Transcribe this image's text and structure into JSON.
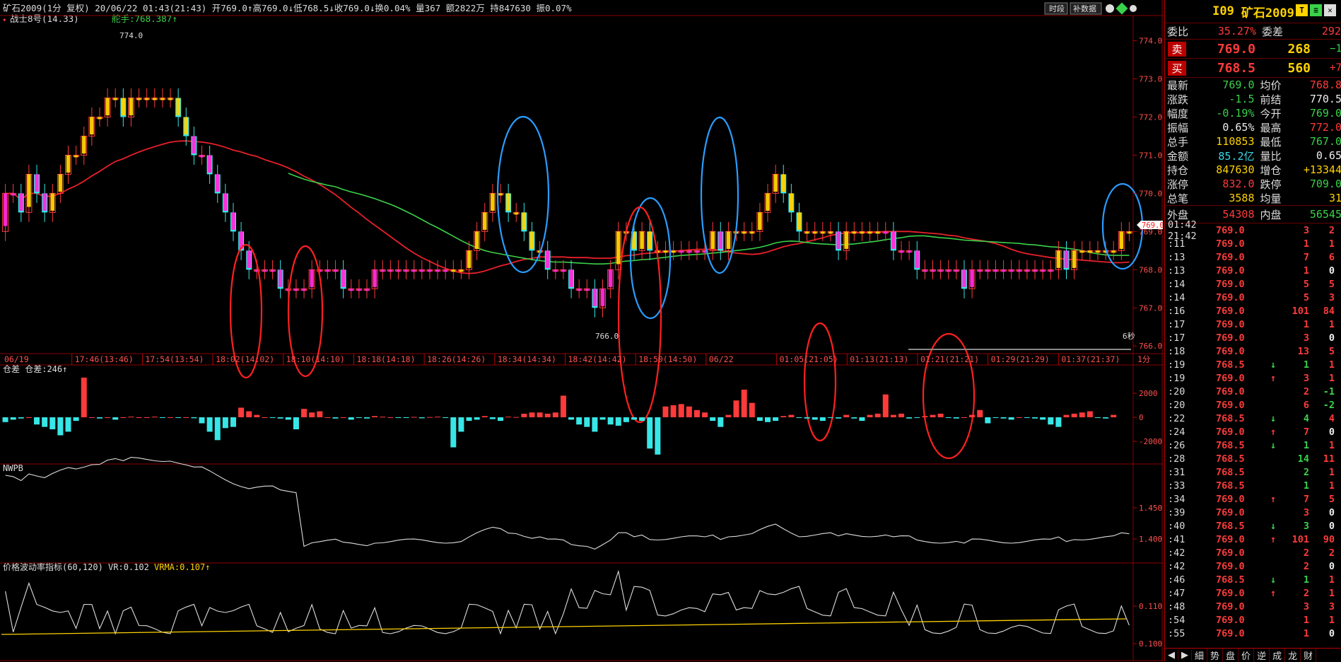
{
  "header": {
    "line1": "矿石2009(1分 复权) 20/06/22 01:43(21:43)  开769.0↑高769.0↓低768.5↓收769.0↓换0.04% 量367 额2822万 持847630 振0.07%",
    "line2_a": "战士8号(14.33)",
    "line2_b": "舵手:768.387↑",
    "btn_period": "时段",
    "btn_data": "补数据"
  },
  "price_axis": [
    "774.0",
    "773.0",
    "772.0",
    "771.0",
    "770.0",
    "769.0",
    "768.0",
    "767.0",
    "766.0"
  ],
  "price_tag": "769.0",
  "hi_label": "774.0",
  "lo_label": "766.0",
  "sec_label": "6秒",
  "time_axis": [
    "06/19",
    "17:46(13:46)",
    "17:54(13:54)",
    "18:02(14:02)",
    "18:10(14:10)",
    "18:18(14:18)",
    "18:26(14:26)",
    "18:34(14:34)",
    "18:42(14:42)",
    "18:50(14:50)",
    "06/22",
    "01:05(21:05)",
    "01:13(21:13)",
    "01:21(21:21)",
    "01:29(21:29)",
    "01:37(21:37)",
    "1分"
  ],
  "ind1": {
    "title": "仓差 仓差:246↑",
    "axis": [
      "2000",
      "0",
      "-2000"
    ]
  },
  "ind2": {
    "title": "NWPB",
    "axis": [
      "1.450",
      "1.400"
    ]
  },
  "ind3": {
    "title_a": "价格波动率指标(60,120) VR:0.102 ",
    "title_b": "VRMA:0.107↑",
    "axis": [
      "0.110",
      "0.100"
    ]
  },
  "chart_data": {
    "type": "candlestick",
    "ylim": [
      765.8,
      774.4
    ],
    "open": [
      769,
      770,
      770,
      769.5,
      770.5,
      770,
      769.5,
      770,
      770.5,
      771,
      771,
      771.5,
      772,
      772,
      772.5,
      772.5,
      772,
      772.5,
      772.5,
      772.5,
      772.5,
      772.5,
      772.5,
      772,
      771.5,
      771,
      771,
      770.5,
      770,
      769.5,
      769,
      768.5,
      768,
      768,
      768,
      768,
      767.5,
      767.5,
      767.5,
      767.5,
      768,
      768,
      768,
      768,
      767.5,
      767.5,
      767.5,
      767.5,
      768,
      768,
      768,
      768,
      768,
      768,
      768,
      768,
      768,
      768,
      768,
      768,
      768.5,
      769,
      769.5,
      770,
      770,
      769.5,
      769.5,
      769,
      768.5,
      768.5,
      768,
      768,
      768,
      767.5,
      767.5,
      767.5,
      767,
      767.5,
      768,
      769,
      769,
      768.5,
      769,
      768.5,
      768.5,
      768.5,
      768.5,
      768.5,
      768.5,
      768.5,
      768.5,
      769,
      768.5,
      769,
      769,
      769,
      769,
      769.5,
      770,
      770.5,
      770,
      769.5,
      769,
      769,
      769,
      769,
      769,
      768.5,
      769,
      769,
      769,
      769,
      769,
      769,
      768.5,
      768.5,
      768.5,
      768,
      768,
      768,
      768,
      768,
      768,
      767.5,
      768,
      768,
      768,
      768,
      768,
      768,
      768,
      768,
      768,
      768,
      768,
      768.5,
      768,
      768.5,
      768.5,
      768.5,
      768.5,
      768.5,
      768.5,
      769
    ],
    "close": [
      770,
      770,
      769.5,
      770.5,
      770,
      769.5,
      770,
      770.5,
      771,
      771,
      771.5,
      772,
      772,
      772.5,
      772.5,
      772,
      772.5,
      772.5,
      772.5,
      772.5,
      772.5,
      772.5,
      772,
      771.5,
      771,
      771,
      770.5,
      770,
      769.5,
      769,
      768.5,
      768,
      768,
      768,
      768,
      767.5,
      767.5,
      767.5,
      767.5,
      768,
      768,
      768,
      768,
      767.5,
      767.5,
      767.5,
      767.5,
      768,
      768,
      768,
      768,
      768,
      768,
      768,
      768,
      768,
      768,
      768,
      768,
      768.5,
      769,
      769.5,
      770,
      770,
      769.5,
      769.5,
      769,
      768.5,
      768.5,
      768,
      768,
      768,
      767.5,
      767.5,
      767.5,
      767,
      767.5,
      768,
      769,
      769,
      768.5,
      769,
      768.5,
      768.5,
      768.5,
      768.5,
      768.5,
      768.5,
      768.5,
      768.5,
      769,
      768.5,
      769,
      769,
      769,
      769,
      769.5,
      770,
      770.5,
      770,
      769.5,
      769,
      769,
      769,
      769,
      769,
      768.5,
      769,
      769,
      769,
      769,
      769,
      769,
      768.5,
      768.5,
      768.5,
      768,
      768,
      768,
      768,
      768,
      768,
      767.5,
      768,
      768,
      768,
      768,
      768,
      768,
      768,
      768,
      768,
      768,
      768,
      768.5,
      768,
      768.5,
      768.5,
      768.5,
      768.5,
      768.5,
      768.5,
      769,
      769
    ],
    "oi_diff": [
      -400,
      -200,
      -100,
      0,
      -600,
      -800,
      -1000,
      -1500,
      -1200,
      -300,
      3300,
      0,
      -100,
      0,
      -200,
      0,
      50,
      0,
      0,
      50,
      -30,
      0,
      -50,
      0,
      -80,
      -500,
      -1200,
      -1900,
      -900,
      -800,
      800,
      500,
      200,
      0,
      -50,
      -100,
      -200,
      -1000,
      700,
      400,
      500,
      0,
      -100,
      0,
      -200,
      -50,
      -100,
      100,
      50,
      0,
      -30,
      -50,
      30,
      -80,
      20,
      50,
      -60,
      -2500,
      -1200,
      -300,
      -200,
      100,
      -150,
      -300,
      50,
      20,
      300,
      400,
      400,
      300,
      400,
      1800,
      -200,
      -600,
      -800,
      -1200,
      -200,
      -600,
      -700,
      -400,
      -200,
      -300,
      -2600,
      -3100,
      900,
      1000,
      1100,
      900,
      600,
      400,
      -300,
      -800,
      200,
      1400,
      2300,
      1200,
      -300,
      -400,
      -300,
      100,
      200,
      -50,
      -100,
      -200,
      -300,
      -50,
      -100,
      200,
      -100,
      -300,
      200,
      300,
      1900,
      200,
      300,
      -100,
      -50,
      100,
      200,
      300,
      -50,
      -100,
      0,
      200,
      600,
      -500,
      -50,
      -100,
      -200,
      0,
      -50,
      -100,
      -200,
      -600,
      -800,
      200,
      300,
      400,
      500,
      -50,
      -100,
      200
    ]
  },
  "panel": {
    "code": "I09",
    "name": "矿石2009",
    "wb_lbl": "委比",
    "wb": "35.27%",
    "wc_lbl": "委差",
    "wc": "292",
    "sell_lbl": "卖",
    "sell_price": "769.0",
    "sell_vol": "268",
    "sell_chg": "−1",
    "buy_lbl": "买",
    "buy_price": "768.5",
    "buy_vol": "560",
    "buy_chg": "+7",
    "stats": [
      {
        "l1": "最新",
        "v1": "769.0",
        "c1": "green",
        "l2": "均价",
        "v2": "768.8",
        "c2": "red"
      },
      {
        "l1": "涨跌",
        "v1": "-1.5",
        "c1": "green",
        "l2": "前结",
        "v2": "770.5",
        "c2": "white"
      },
      {
        "l1": "幅度",
        "v1": "-0.19%",
        "c1": "green",
        "l2": "今开",
        "v2": "769.0",
        "c2": "green"
      },
      {
        "l1": "振幅",
        "v1": "0.65%",
        "c1": "white",
        "l2": "最高",
        "v2": "772.0",
        "c2": "red"
      },
      {
        "l1": "总手",
        "v1": "110853",
        "c1": "yellow",
        "l2": "最低",
        "v2": "767.0",
        "c2": "green"
      },
      {
        "l1": "金额",
        "v1": "85.2亿",
        "c1": "cyan",
        "l2": "量比",
        "v2": "0.65",
        "c2": "white"
      },
      {
        "l1": "持仓",
        "v1": "847630",
        "c1": "yellow",
        "l2": "增仓",
        "v2": "+13344",
        "c2": "yellow"
      },
      {
        "l1": "涨停",
        "v1": "832.0",
        "c1": "red",
        "l2": "跌停",
        "v2": "709.0",
        "c2": "green"
      },
      {
        "l1": "总笔",
        "v1": "3588",
        "c1": "yellow",
        "l2": "均量",
        "v2": "31",
        "c2": "yellow"
      }
    ],
    "outer_lbl": "外盘",
    "outer": "54308",
    "inner_lbl": "内盘",
    "inner": "56545",
    "ticks": [
      {
        "t": "01:42 21:42",
        "p": "769.0",
        "pc": "red",
        "a": "",
        "v": "3",
        "vc": "red",
        "d": "2",
        "dc": "red"
      },
      {
        "t": ":11",
        "p": "769.0",
        "pc": "red",
        "a": "",
        "v": "1",
        "vc": "red",
        "d": "1",
        "dc": "red"
      },
      {
        "t": ":13",
        "p": "769.0",
        "pc": "red",
        "a": "",
        "v": "7",
        "vc": "red",
        "d": "6",
        "dc": "red"
      },
      {
        "t": ":13",
        "p": "769.0",
        "pc": "red",
        "a": "",
        "v": "1",
        "vc": "red",
        "d": "0",
        "dc": "white"
      },
      {
        "t": ":14",
        "p": "769.0",
        "pc": "red",
        "a": "",
        "v": "5",
        "vc": "red",
        "d": "5",
        "dc": "red"
      },
      {
        "t": ":14",
        "p": "769.0",
        "pc": "red",
        "a": "",
        "v": "5",
        "vc": "red",
        "d": "3",
        "dc": "red"
      },
      {
        "t": ":16",
        "p": "769.0",
        "pc": "red",
        "a": "",
        "v": "101",
        "vc": "red",
        "d": "84",
        "dc": "red"
      },
      {
        "t": ":17",
        "p": "769.0",
        "pc": "red",
        "a": "",
        "v": "1",
        "vc": "red",
        "d": "1",
        "dc": "red"
      },
      {
        "t": ":17",
        "p": "769.0",
        "pc": "red",
        "a": "",
        "v": "3",
        "vc": "red",
        "d": "0",
        "dc": "white"
      },
      {
        "t": ":18",
        "p": "769.0",
        "pc": "red",
        "a": "",
        "v": "13",
        "vc": "red",
        "d": "5",
        "dc": "red"
      },
      {
        "t": ":19",
        "p": "768.5",
        "pc": "red",
        "a": "↓",
        "ac": "green",
        "v": "1",
        "vc": "green",
        "d": "1",
        "dc": "red"
      },
      {
        "t": ":19",
        "p": "769.0",
        "pc": "red",
        "a": "↑",
        "ac": "red",
        "v": "3",
        "vc": "red",
        "d": "1",
        "dc": "red"
      },
      {
        "t": ":20",
        "p": "769.0",
        "pc": "red",
        "a": "",
        "v": "2",
        "vc": "red",
        "d": "-1",
        "dc": "green"
      },
      {
        "t": ":20",
        "p": "769.0",
        "pc": "red",
        "a": "",
        "v": "6",
        "vc": "red",
        "d": "-2",
        "dc": "green"
      },
      {
        "t": ":22",
        "p": "768.5",
        "pc": "red",
        "a": "↓",
        "ac": "green",
        "v": "4",
        "vc": "green",
        "d": "4",
        "dc": "red"
      },
      {
        "t": ":24",
        "p": "769.0",
        "pc": "red",
        "a": "↑",
        "ac": "red",
        "v": "7",
        "vc": "red",
        "d": "0",
        "dc": "white"
      },
      {
        "t": ":26",
        "p": "768.5",
        "pc": "red",
        "a": "↓",
        "ac": "green",
        "v": "1",
        "vc": "green",
        "d": "1",
        "dc": "red"
      },
      {
        "t": ":28",
        "p": "768.5",
        "pc": "red",
        "a": "",
        "v": "14",
        "vc": "green",
        "d": "11",
        "dc": "red"
      },
      {
        "t": ":31",
        "p": "768.5",
        "pc": "red",
        "a": "",
        "v": "2",
        "vc": "green",
        "d": "1",
        "dc": "red"
      },
      {
        "t": ":33",
        "p": "768.5",
        "pc": "red",
        "a": "",
        "v": "1",
        "vc": "green",
        "d": "1",
        "dc": "red"
      },
      {
        "t": ":34",
        "p": "769.0",
        "pc": "red",
        "a": "↑",
        "ac": "red",
        "v": "7",
        "vc": "red",
        "d": "5",
        "dc": "red"
      },
      {
        "t": ":39",
        "p": "769.0",
        "pc": "red",
        "a": "",
        "v": "3",
        "vc": "red",
        "d": "0",
        "dc": "white"
      },
      {
        "t": ":40",
        "p": "768.5",
        "pc": "red",
        "a": "↓",
        "ac": "green",
        "v": "3",
        "vc": "green",
        "d": "0",
        "dc": "white"
      },
      {
        "t": ":41",
        "p": "769.0",
        "pc": "red",
        "a": "↑",
        "ac": "red",
        "v": "101",
        "vc": "red",
        "d": "90",
        "dc": "red"
      },
      {
        "t": ":42",
        "p": "769.0",
        "pc": "red",
        "a": "",
        "v": "2",
        "vc": "red",
        "d": "2",
        "dc": "red"
      },
      {
        "t": ":42",
        "p": "769.0",
        "pc": "red",
        "a": "",
        "v": "2",
        "vc": "red",
        "d": "0",
        "dc": "white"
      },
      {
        "t": ":46",
        "p": "768.5",
        "pc": "red",
        "a": "↓",
        "ac": "green",
        "v": "1",
        "vc": "green",
        "d": "1",
        "dc": "red"
      },
      {
        "t": ":47",
        "p": "769.0",
        "pc": "red",
        "a": "↑",
        "ac": "red",
        "v": "2",
        "vc": "red",
        "d": "1",
        "dc": "red"
      },
      {
        "t": ":48",
        "p": "769.0",
        "pc": "red",
        "a": "",
        "v": "3",
        "vc": "red",
        "d": "3",
        "dc": "red"
      },
      {
        "t": ":54",
        "p": "769.0",
        "pc": "red",
        "a": "",
        "v": "1",
        "vc": "red",
        "d": "1",
        "dc": "red"
      },
      {
        "t": ":55",
        "p": "769.0",
        "pc": "red",
        "a": "",
        "v": "1",
        "vc": "red",
        "d": "0",
        "dc": "white"
      }
    ],
    "tabs": [
      "◀",
      "▶",
      "細",
      "势",
      "盘",
      "价",
      "逆",
      "成",
      "龙",
      "财"
    ]
  },
  "colors": {
    "bg": "#000000",
    "up": "#ff3a3a",
    "down": "#37e6e6",
    "ma_red": "#e8202a",
    "ma_green": "#3ad24a",
    "grid": "#8b0000",
    "yellow": "#ffd200",
    "magenta": "#ff2ad9"
  }
}
